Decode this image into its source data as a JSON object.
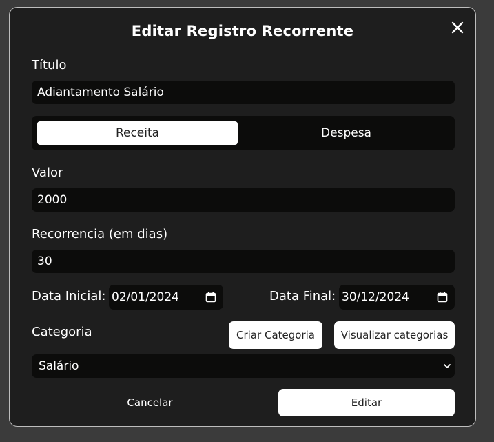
{
  "modal": {
    "title": "Editar Registro Recorrente",
    "close_icon": "close-icon"
  },
  "fields": {
    "titulo_label": "Título",
    "titulo_value": "Adiantamento Salário",
    "type_toggle": {
      "options": [
        "Receita",
        "Despesa"
      ],
      "selected": "Receita"
    },
    "valor_label": "Valor",
    "valor_value": "2000",
    "recorrencia_label": "Recorrencia (em dias)",
    "recorrencia_value": "30",
    "data_inicial_label": "Data Inicial:",
    "data_inicial_value": "02/01/2024",
    "data_final_label": "Data Final:",
    "data_final_value": "30/12/2024",
    "categoria_label": "Categoria",
    "categoria_value": "Salário"
  },
  "buttons": {
    "criar_categoria": "Criar Categoria",
    "visualizar_categorias": "Visualizar categorias",
    "cancelar": "Cancelar",
    "editar": "Editar"
  },
  "icons": {
    "calendar": "calendar-icon",
    "chevron": "chevron-down-icon"
  },
  "colors": {
    "modal_bg": "#1e1e1e",
    "field_bg": "#0c0c0b",
    "active_toggle": "#ffffff",
    "backdrop": "#3b3b3b"
  }
}
